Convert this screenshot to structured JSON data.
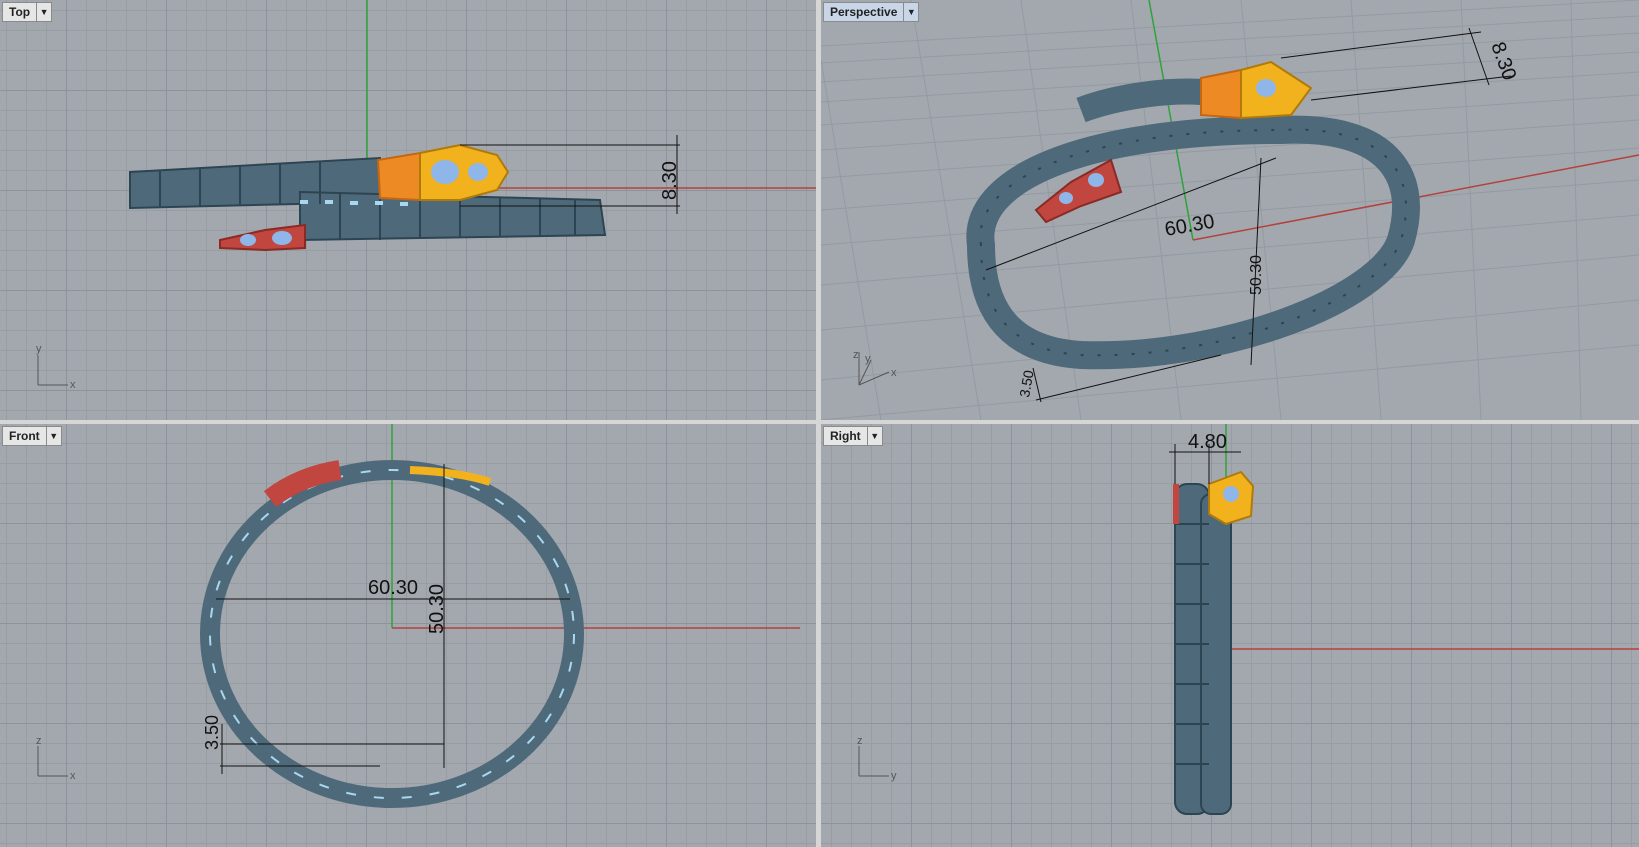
{
  "viewports": {
    "top": {
      "label": "Top",
      "dims": {
        "height": "8.30"
      }
    },
    "persp": {
      "label": "Perspective",
      "dims": {
        "height": "8.30",
        "width": "60.30",
        "vertical": "50.30",
        "thickness": "3.50"
      }
    },
    "front": {
      "label": "Front",
      "dims": {
        "width": "60.30",
        "vertical": "50.30",
        "thickness": "3.50"
      }
    },
    "right": {
      "label": "Right",
      "dims": {
        "width": "4.80"
      }
    }
  },
  "axes": {
    "top": {
      "v": "y",
      "h": "x"
    },
    "persp": {
      "v": "z",
      "h": "x",
      "d": "y"
    },
    "front": {
      "v": "z",
      "h": "x"
    },
    "right": {
      "v": "z",
      "h": "y"
    }
  },
  "colors": {
    "body": "#4e6a7a",
    "head_gold": "#f2b21e",
    "head_orange": "#ee8a23",
    "tail_red": "#c0463f",
    "accent_blue": "#8fb6e8",
    "x_axis": "#b3423d",
    "y_axis": "#2fa23a"
  }
}
